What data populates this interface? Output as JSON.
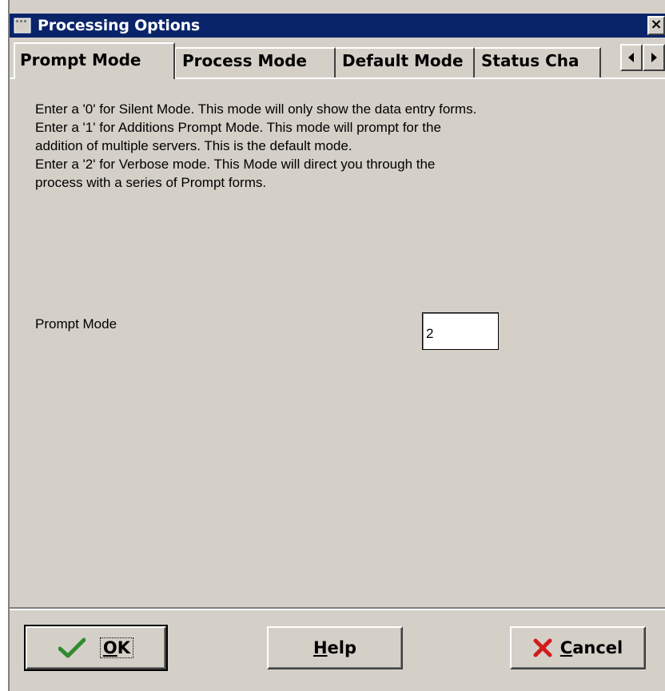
{
  "window": {
    "title": "Processing Options",
    "close_glyph": "×"
  },
  "tabs": [
    {
      "label": "Prompt Mode",
      "active": true
    },
    {
      "label": "Process Mode",
      "active": false
    },
    {
      "label": "Default Mode",
      "active": false
    },
    {
      "label": "Status Cha",
      "active": false
    }
  ],
  "tab_scroll": {
    "left_icon": "left-arrow-icon",
    "right_icon": "right-arrow-icon"
  },
  "page": {
    "description_lines": [
      "Enter a '0' for Silent Mode.  This mode will only show the data entry forms.",
      "Enter a '1' for Additions Prompt Mode.  This mode will prompt for the",
      "addition of multiple servers.  This is the default mode.",
      "Enter a '2' for Verbose mode.  This Mode will direct you through the",
      "process with a series of Prompt forms."
    ],
    "field_label": "Prompt Mode",
    "field_value": "2"
  },
  "buttons": {
    "ok": {
      "label_first": "O",
      "label_rest": "K",
      "icon": "checkmark-icon"
    },
    "help": {
      "label_first": "H",
      "label_rest": "elp"
    },
    "cancel": {
      "label_first": "C",
      "label_rest": "ancel",
      "icon": "red-x-icon"
    }
  },
  "colors": {
    "titlebar": "#0a246a",
    "face": "#d4d0c8",
    "checkmark": "#2e8b2e",
    "cancel_x": "#d21c1c"
  }
}
